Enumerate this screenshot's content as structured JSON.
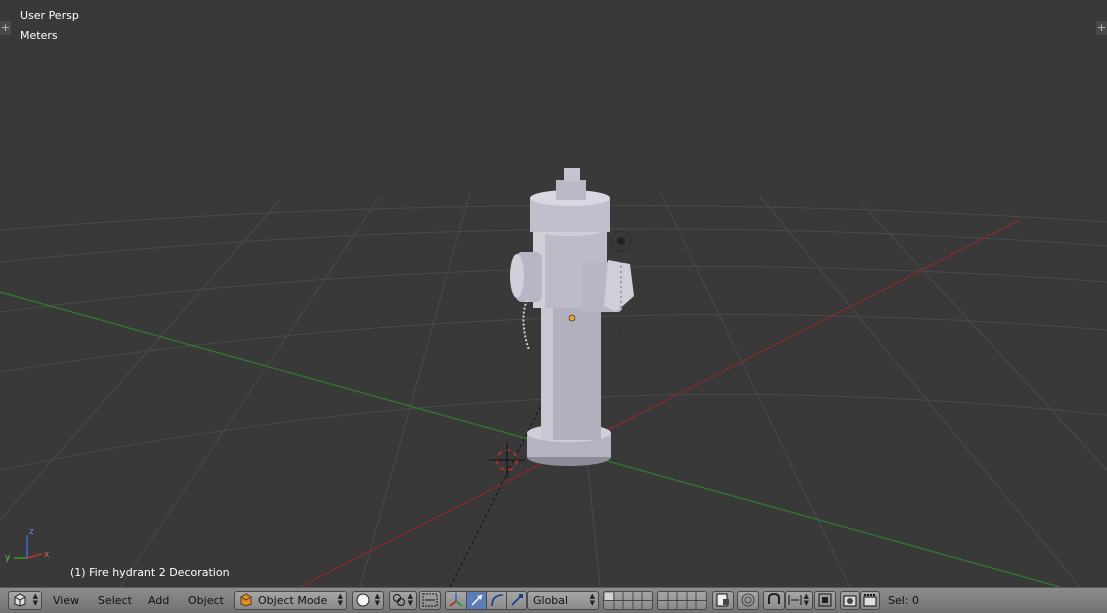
{
  "viewport": {
    "view_name": "User Persp",
    "units": "Meters",
    "object_info": "(1) Fire hydrant 2 Decoration",
    "axis_labels": {
      "z": "z",
      "y": "y",
      "x": "x"
    },
    "colors": {
      "background": "#393939",
      "grid": "#4a4a4a",
      "x_axis": "#8c2b2b",
      "y_axis": "#2f7e2f",
      "hydrant": "#b6b6c4",
      "origin_dot": "#f0a030"
    }
  },
  "header": {
    "menus": [
      "View",
      "Select",
      "Add",
      "Object"
    ],
    "mode": "Object Mode",
    "orientation": "Global",
    "sel": "Sel: 0",
    "icons": [
      "editor-type-icon",
      "viewport-shading-icon",
      "pivot-point-icon",
      "manipulator-toggle-icon",
      "translate-manipulator-icon",
      "rotate-manipulator-icon",
      "scale-manipulator-icon",
      "layer-buttons",
      "lock-layers-icon",
      "proportional-edit-icon",
      "snap-icon",
      "snap-element-icon",
      "snap-target-icon",
      "opengl-render-icon",
      "opengl-animation-icon"
    ]
  }
}
